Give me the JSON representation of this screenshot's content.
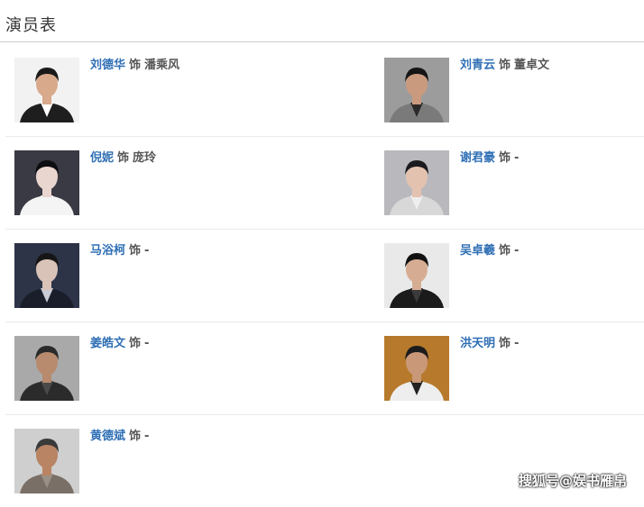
{
  "section_title": "演员表",
  "as_label": "饰",
  "cast": [
    {
      "actor": "刘德华",
      "role": "潘乘风",
      "bg": "#f2f2f2",
      "skin": "#d8a98a",
      "hair": "#1a1a1a",
      "cloth": "#1e1e1e",
      "shirt": "#ffffff"
    },
    {
      "actor": "刘青云",
      "role": "董卓文",
      "bg": "#9c9c9c",
      "skin": "#c99a7e",
      "hair": "#151515",
      "cloth": "#7a7a7a",
      "shirt": "#2a2a2a"
    },
    {
      "actor": "倪妮",
      "role": "庞玲",
      "bg": "#3a3a44",
      "skin": "#e9d6cf",
      "hair": "#0e0e12",
      "cloth": "#f4f4f4",
      "shirt": "#f4f4f4"
    },
    {
      "actor": "谢君豪",
      "role": "-",
      "bg": "#b9b9bd",
      "skin": "#e3c2b0",
      "hair": "#1b1b1f",
      "cloth": "#d8d8d8",
      "shirt": "#eeeeee"
    },
    {
      "actor": "马浴柯",
      "role": "-",
      "bg": "#2d3447",
      "skin": "#d9c2b8",
      "hair": "#161616",
      "cloth": "#1a1d2a",
      "shirt": "#c9ccd6"
    },
    {
      "actor": "吴卓羲",
      "role": "-",
      "bg": "#e9e9e9",
      "skin": "#d6ad93",
      "hair": "#121212",
      "cloth": "#1b1b1b",
      "shirt": "#3b3b3b"
    },
    {
      "actor": "姜皓文",
      "role": "-",
      "bg": "#a9a9a9",
      "skin": "#b88a6e",
      "hair": "#2a2a2a",
      "cloth": "#2b2b2b",
      "shirt": "#4a4a4a"
    },
    {
      "actor": "洪天明",
      "role": "-",
      "bg": "#b77a2c",
      "skin": "#c99878",
      "hair": "#1c1c1c",
      "cloth": "#eeeeee",
      "shirt": "#222222"
    },
    {
      "actor": "黄德斌",
      "role": "-",
      "bg": "#cfcfcf",
      "skin": "#b88463",
      "hair": "#3a3a3a",
      "cloth": "#7a6f66",
      "shirt": "#9a8f85"
    }
  ],
  "watermark": "搜狐号@娱书雁帛"
}
